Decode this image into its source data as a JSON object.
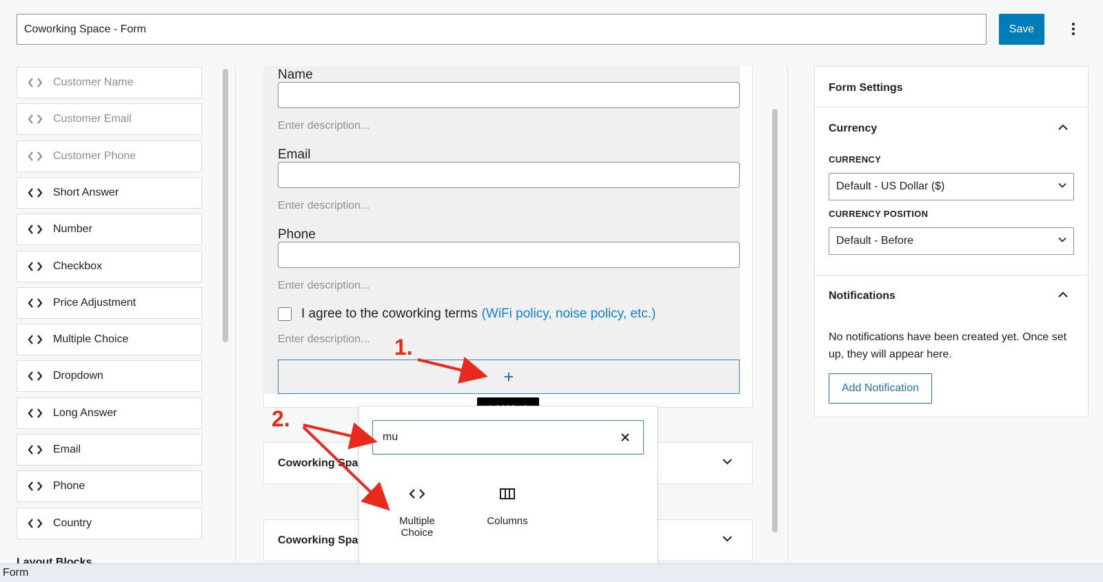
{
  "header": {
    "form_title": "Coworking Space - Form",
    "save_label": "Save",
    "more_icon": "vertical-ellipsis-icon"
  },
  "palette": {
    "items": [
      {
        "label": "Customer Name",
        "disabled": true
      },
      {
        "label": "Customer Email",
        "disabled": true
      },
      {
        "label": "Customer Phone",
        "disabled": true
      },
      {
        "label": "Short Answer",
        "disabled": false
      },
      {
        "label": "Number",
        "disabled": false
      },
      {
        "label": "Checkbox",
        "disabled": false
      },
      {
        "label": "Price Adjustment",
        "disabled": false
      },
      {
        "label": "Multiple Choice",
        "disabled": false
      },
      {
        "label": "Dropdown",
        "disabled": false
      },
      {
        "label": "Long Answer",
        "disabled": false
      },
      {
        "label": "Email",
        "disabled": false
      },
      {
        "label": "Phone",
        "disabled": false
      },
      {
        "label": "Country",
        "disabled": false
      }
    ],
    "layout_heading": "Layout Blocks"
  },
  "canvas": {
    "fields": [
      {
        "label": "Name",
        "description_placeholder": "Enter description..."
      },
      {
        "label": "Email",
        "description_placeholder": "Enter description..."
      },
      {
        "label": "Phone",
        "description_placeholder": "Enter description..."
      }
    ],
    "agree_text": "I agree to the coworking terms",
    "agree_link": "(WiFi policy, noise policy, etc.)",
    "agree_description": "Enter description...",
    "add_icon": "+",
    "add_tooltip": "Add block",
    "collapsed_blocks": [
      {
        "label": "Coworking Spa"
      },
      {
        "label": "Coworking Spa"
      }
    ]
  },
  "inserter": {
    "search_value": "mu",
    "results": [
      {
        "label_line1": "Multiple",
        "label_line2": "Choice",
        "icon": "code-brackets-icon"
      },
      {
        "label_line1": "Columns",
        "label_line2": "",
        "icon": "columns-icon"
      }
    ]
  },
  "settings": {
    "title": "Form Settings",
    "currency_section": "Currency",
    "currency_label": "CURRENCY",
    "currency_value": "Default - US Dollar ($)",
    "position_label": "CURRENCY POSITION",
    "position_value": "Default - Before",
    "notifications_section": "Notifications",
    "notifications_text": "No notifications have been created yet. Once set up, they will appear here.",
    "add_notification_label": "Add Notification"
  },
  "status_bar": {
    "text": "Form"
  },
  "annotations": {
    "step1": "1.",
    "step2": "2.",
    "color": "#e8291c"
  },
  "colors": {
    "accent": "#007cba",
    "link": "#0a84d6"
  }
}
